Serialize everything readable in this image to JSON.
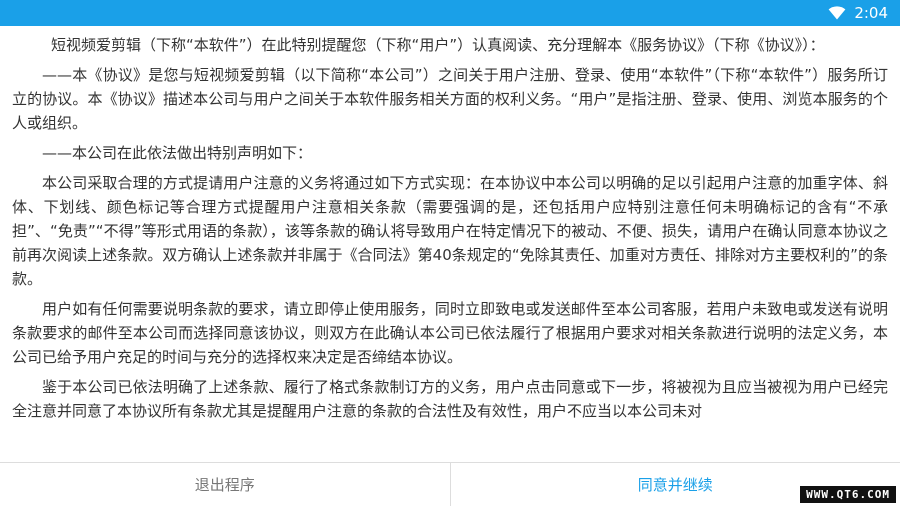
{
  "status_bar": {
    "time": "2:04",
    "wifi_icon": "wifi-icon",
    "color": "#1aa0e8"
  },
  "agreement": {
    "paragraphs": [
      "短视频爱剪辑（下称“本软件”）在此特别提醒您（下称“用户”）认真阅读、充分理解本《服务协议》（下称《协议》）：",
      "——本《协议》是您与短视频爱剪辑（以下简称“本公司”）之间关于用户注册、登录、使用“本软件”（下称“本软件”）服务所订立的协议。本《协议》描述本公司与用户之间关于本软件服务相关方面的权利义务。“用户”是指注册、登录、使用、浏览本服务的个人或组织。",
      "——本公司在此依法做出特别声明如下：",
      "本公司采取合理的方式提请用户注意的义务将通过如下方式实现：在本协议中本公司以明确的足以引起用户注意的加重字体、斜体、下划线、颜色标记等合理方式提醒用户注意相关条款（需要强调的是，还包括用户应特别注意任何未明确标记的含有“不承担”、“免责”“不得”等形式用语的条款），该等条款的确认将导致用户在特定情况下的被动、不便、损失，请用户在确认同意本协议之前再次阅读上述条款。双方确认上述条款并非属于《合同法》第40条规定的“免除其责任、加重对方责任、排除对方主要权利的”的条款。",
      "用户如有任何需要说明条款的要求，请立即停止使用服务，同时立即致电或发送邮件至本公司客服，若用户未致电或发送有说明条款要求的邮件至本公司而选择同意该协议，则双方在此确认本公司已依法履行了根据用户要求对相关条款进行说明的法定义务，本公司已给予用户充足的时间与充分的选择权来决定是否缔结本协议。",
      "鉴于本公司已依法明确了上述条款、履行了格式条款制订方的义务，用户点击同意或下一步，将被视为且应当被视为用户已经完全注意并同意了本协议所有条款尤其是提醒用户注意的条款的合法性及有效性，用户不应当以本公司未对"
    ]
  },
  "buttons": {
    "exit_label": "退出程序",
    "agree_label": "同意并继续",
    "accent_color": "#1aa0e8"
  },
  "watermark": {
    "text": "WWW.QT6.COM"
  }
}
